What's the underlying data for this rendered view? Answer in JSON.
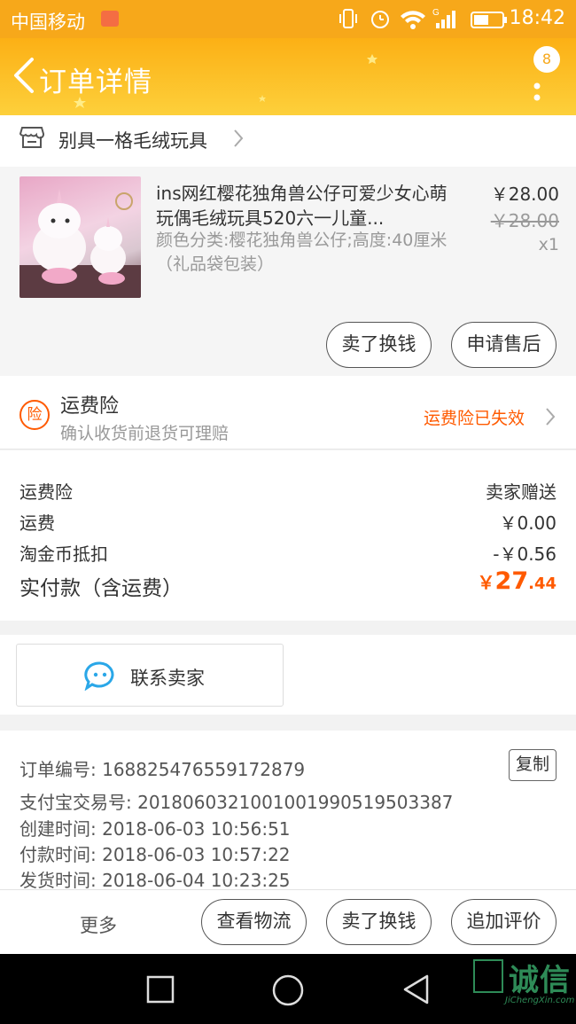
{
  "status": {
    "carrier": "中国移动",
    "time": "18:42",
    "network": "G"
  },
  "header": {
    "title": "订单详情",
    "badge": "8"
  },
  "shop": {
    "name": "别具一格毛绒玩具"
  },
  "item": {
    "title": "ins网红樱花独角兽公仔可爱少女心萌玩偶毛绒玩具520六一儿童...",
    "sku": "颜色分类:樱花独角兽公仔;高度:40厘米（礼品袋包装）",
    "price": "￥28.00",
    "original_price": "￥28.00",
    "quantity": "x1",
    "actions": [
      "卖了换钱",
      "申请售后"
    ]
  },
  "insurance": {
    "title": "运费险",
    "subtitle": "确认收货前退货可理赔",
    "status": "运费险已失效",
    "icon_text": "险"
  },
  "fees": [
    {
      "label": "运费险",
      "value": "卖家赠送"
    },
    {
      "label": "运费",
      "value": "￥0.00"
    },
    {
      "label": "淘金币抵扣",
      "value": "-￥0.56"
    }
  ],
  "total": {
    "label": "实付款（含运费）",
    "currency": "￥",
    "integer": "27",
    "decimal": ".44"
  },
  "contact": {
    "label": "联系卖家"
  },
  "order_info": {
    "copy_label": "复制",
    "rows": [
      {
        "label": "订单编号:",
        "value": "168825476559172879"
      },
      {
        "label": "支付宝交易号:",
        "value": "2018060321001001990519503387"
      },
      {
        "label": "创建时间:",
        "value": "2018-06-03 10:56:51"
      },
      {
        "label": "付款时间:",
        "value": "2018-06-03 10:57:22"
      },
      {
        "label": "发货时间:",
        "value": "2018-06-04 10:23:25"
      }
    ]
  },
  "bottom_bar": {
    "more": "更多",
    "buttons": [
      "查看物流",
      "卖了换钱",
      "追加评价"
    ]
  },
  "watermark": {
    "text": "诚信",
    "sub": "JiChengXin.com"
  },
  "colors": {
    "brand": "#f7a81a",
    "accent": "#ff5a00",
    "contact_icon": "#2aa7e8"
  }
}
